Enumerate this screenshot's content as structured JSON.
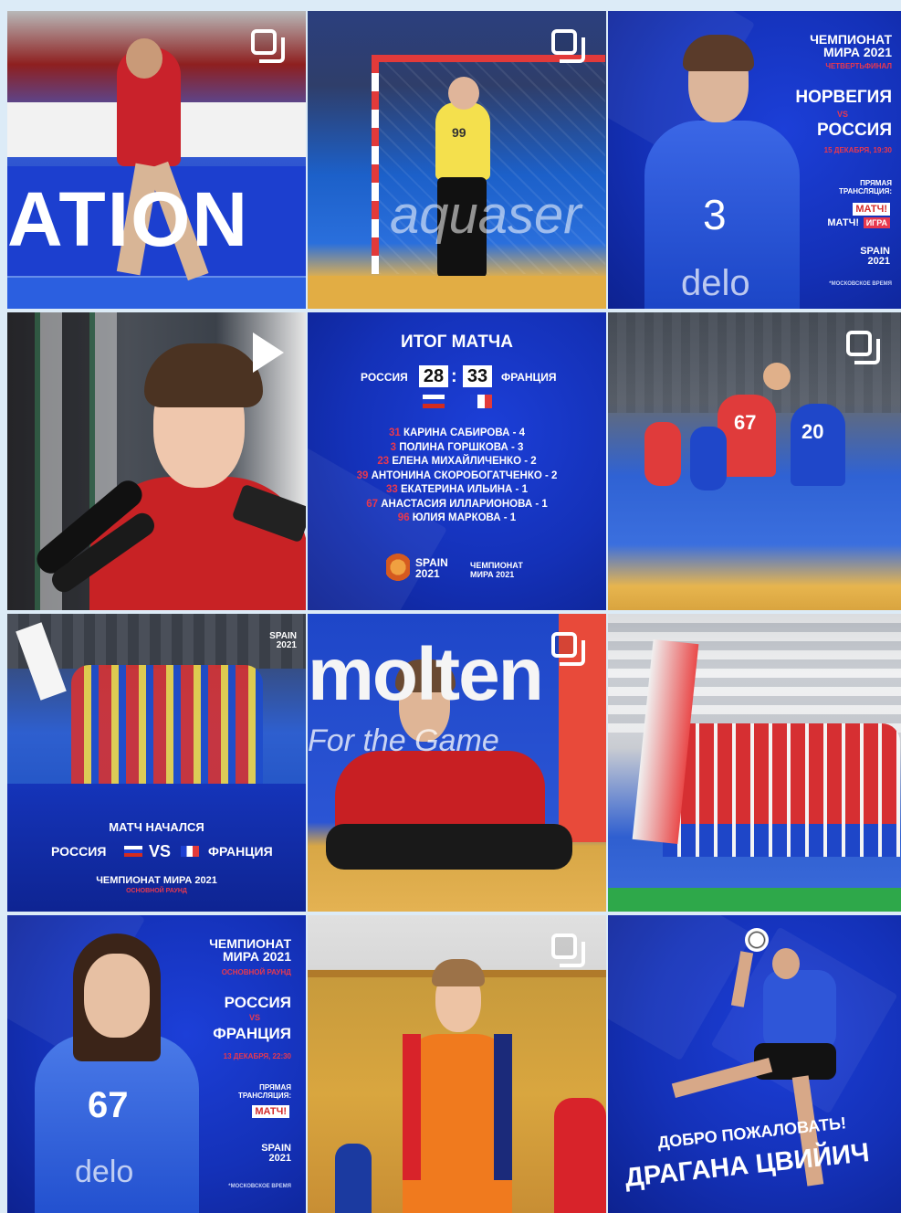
{
  "colors": {
    "brand_blue": "#1431b8",
    "accent_red": "#e8384f",
    "team_red": "#d42b2b",
    "court_blue": "#2f5fd0"
  },
  "posts": [
    {
      "id": "p1",
      "icon": "multi-photo-icon",
      "banner": "ATION"
    },
    {
      "id": "p2",
      "icon": "multi-photo-icon",
      "jersey": "99",
      "banner": "aquaser"
    },
    {
      "id": "p3",
      "championship": "ЧЕМПИОНАТ МИРА 2021",
      "stage": "ЧЕТВЕРТЬФИНАЛ",
      "team1": "НОРВЕГИЯ",
      "vs": "VS",
      "team2": "РОССИЯ",
      "date": "15 ДЕКАБРЯ, 19:30",
      "broadcast": "ПРЯМАЯ ТРАНСЛЯЦИЯ:",
      "ch1": "МАТЧ!",
      "ch2": "МАТЧ!",
      "ch2b": "ИГРА",
      "logo": "SPAIN 2021",
      "tz": "*МОСКОВСКОЕ ВРЕМЯ",
      "jersey": "3",
      "sponsor": "delo"
    },
    {
      "id": "p4",
      "icon": "video-play-icon"
    },
    {
      "id": "p5",
      "title": "ИТОГ МАТЧА",
      "team1": "РОССИЯ",
      "score1": "28",
      "score2": "33",
      "team2": "ФРАНЦИЯ",
      "scorers": [
        {
          "num": "31",
          "name": "КАРИНА САБИРОВА - 4"
        },
        {
          "num": "3",
          "name": "ПОЛИНА ГОРШКОВА - 3"
        },
        {
          "num": "23",
          "name": "ЕЛЕНА МИХАЙЛИЧЕНКО - 2"
        },
        {
          "num": "39",
          "name": "АНТОНИНА СКОРОБОГАТЧЕНКО - 2"
        },
        {
          "num": "33",
          "name": "ЕКАТЕРИНА ИЛЬИНА - 1"
        },
        {
          "num": "67",
          "name": "АНАСТАСИЯ ИЛЛАРИОНОВА - 1"
        },
        {
          "num": "96",
          "name": "ЮЛИЯ МАРКОВА - 1"
        }
      ],
      "logo": "SPAIN 2021",
      "champ": "ЧЕМПИОНАТ МИРА 2021"
    },
    {
      "id": "p6",
      "icon": "multi-photo-icon",
      "jersey1": "67",
      "jersey2": "20"
    },
    {
      "id": "p7",
      "logo": "SPAIN 2021",
      "title": "МАТЧ НАЧАЛСЯ",
      "team1": "РОССИЯ",
      "vs": "VS",
      "team2": "ФРАНЦИЯ",
      "champ": "ЧЕМПИОНАТ МИРА 2021",
      "stage": "ОСНОВНОЙ РАУНД"
    },
    {
      "id": "p8",
      "icon": "multi-photo-icon",
      "banner": "molten",
      "banner2": "For the Game"
    },
    {
      "id": "p9"
    },
    {
      "id": "p10",
      "championship": "ЧЕМПИОНАТ МИРА 2021",
      "stage": "ОСНОВНОЙ РАУНД",
      "team1": "РОССИЯ",
      "vs": "VS",
      "team2": "ФРАНЦИЯ",
      "date": "13 ДЕКАБРЯ, 22:30",
      "broadcast": "ПРЯМАЯ ТРАНСЛЯЦИЯ:",
      "ch1": "МАТЧ!",
      "logo": "SPAIN 2021",
      "tz": "*МОСКОВСКОЕ ВРЕМЯ",
      "jersey": "67",
      "sponsor": "delo"
    },
    {
      "id": "p11",
      "icon": "multi-photo-icon"
    },
    {
      "id": "p12",
      "line1": "ДОБРО ПОЖАЛОВАТЬ!",
      "line2": "ДРАГАНА ЦВИЙИЧ"
    }
  ]
}
